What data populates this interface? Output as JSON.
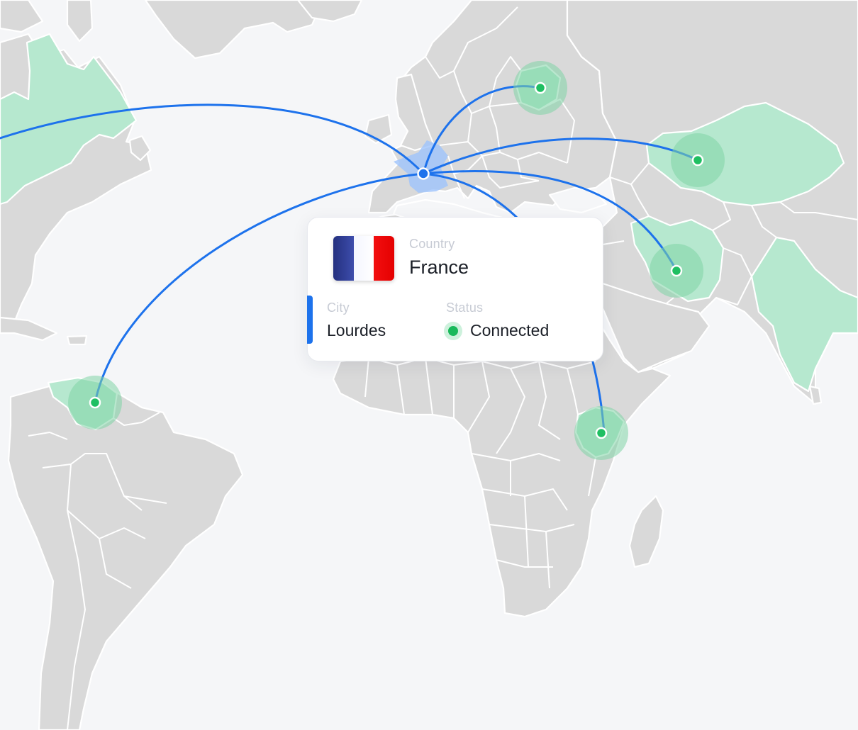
{
  "map": {
    "origin": {
      "name": "France",
      "node_color": "#1d72ec"
    },
    "connection_color": "#1d72ec",
    "node_color": "#1fbf62",
    "highlight_color": "#b6e8cf",
    "connected_regions": [
      "Canada",
      "Venezuela",
      "Belarus",
      "Kazakhstan",
      "Iran",
      "India",
      "Kenya"
    ]
  },
  "card": {
    "flag": "france-flag",
    "country_label": "Country",
    "country": "France",
    "city_label": "City",
    "city": "Lourdes",
    "status_label": "Status",
    "status": "Connected",
    "status_color": "#18b95a"
  }
}
